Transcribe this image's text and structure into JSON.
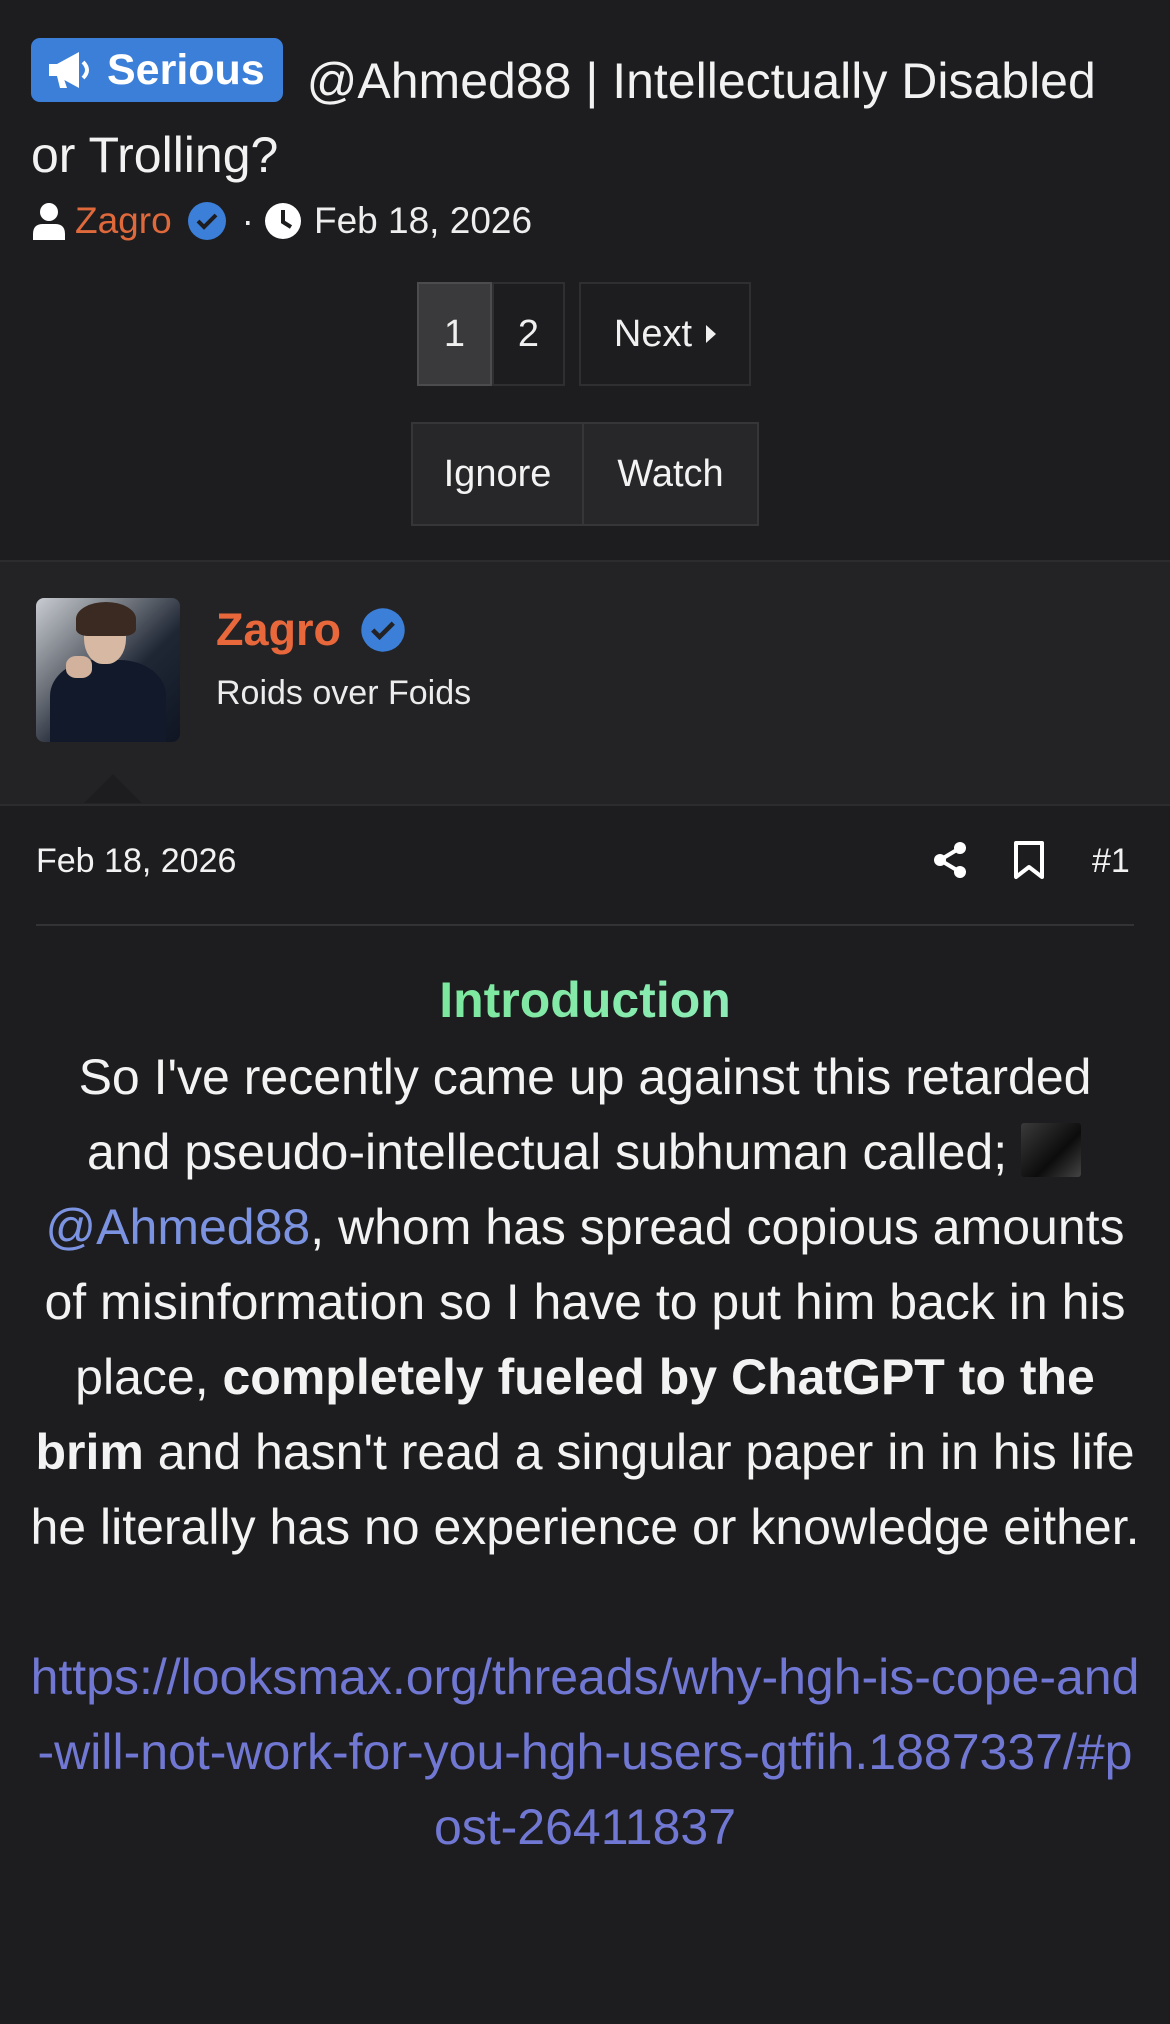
{
  "thread": {
    "prefix": "Serious",
    "title": "@Ahmed88 | Intellectually Disabled or Trolling?",
    "author": "Zagro",
    "meta_separator": "·",
    "date": "Feb 18, 2026"
  },
  "pagination": {
    "page1": "1",
    "page2": "2",
    "next": "Next"
  },
  "actions": {
    "ignore": "Ignore",
    "watch": "Watch"
  },
  "post": {
    "author": "Zagro",
    "user_title": "Roids over Foids",
    "date": "Feb 18, 2026",
    "number": "#1",
    "heading": "Introduction",
    "text_1": "So I've recently came up against this retarded and pseudo-intellectual subhuman called; ",
    "mention": "@Ahmed88",
    "text_2": ", whom has spread copious amounts of misinformation so I have to put him back in his place, ",
    "text_bold": "completely fueled by ChatGPT to the brim",
    "text_3": " and hasn't read a singular paper in in his life he literally has no experience or knowledge either.",
    "link": "https://looksmax.org/threads/why-hgh-is-cope-and-will-not-work-for-you-hgh-users-gtfih.1887337/#post-26411837"
  },
  "colors": {
    "background": "#1d1d1f",
    "badge": "#3b7fd9",
    "username": "#e8683c",
    "verified": "#3b7fd9",
    "mention": "#7b93e0",
    "link": "#7178d4",
    "heading_gradient": [
      "#63e07a",
      "#a6f3d9"
    ]
  },
  "icons": [
    "megaphone-icon",
    "user-icon",
    "verified-icon",
    "clock-icon",
    "caret-right-icon",
    "share-icon",
    "bookmark-icon"
  ]
}
